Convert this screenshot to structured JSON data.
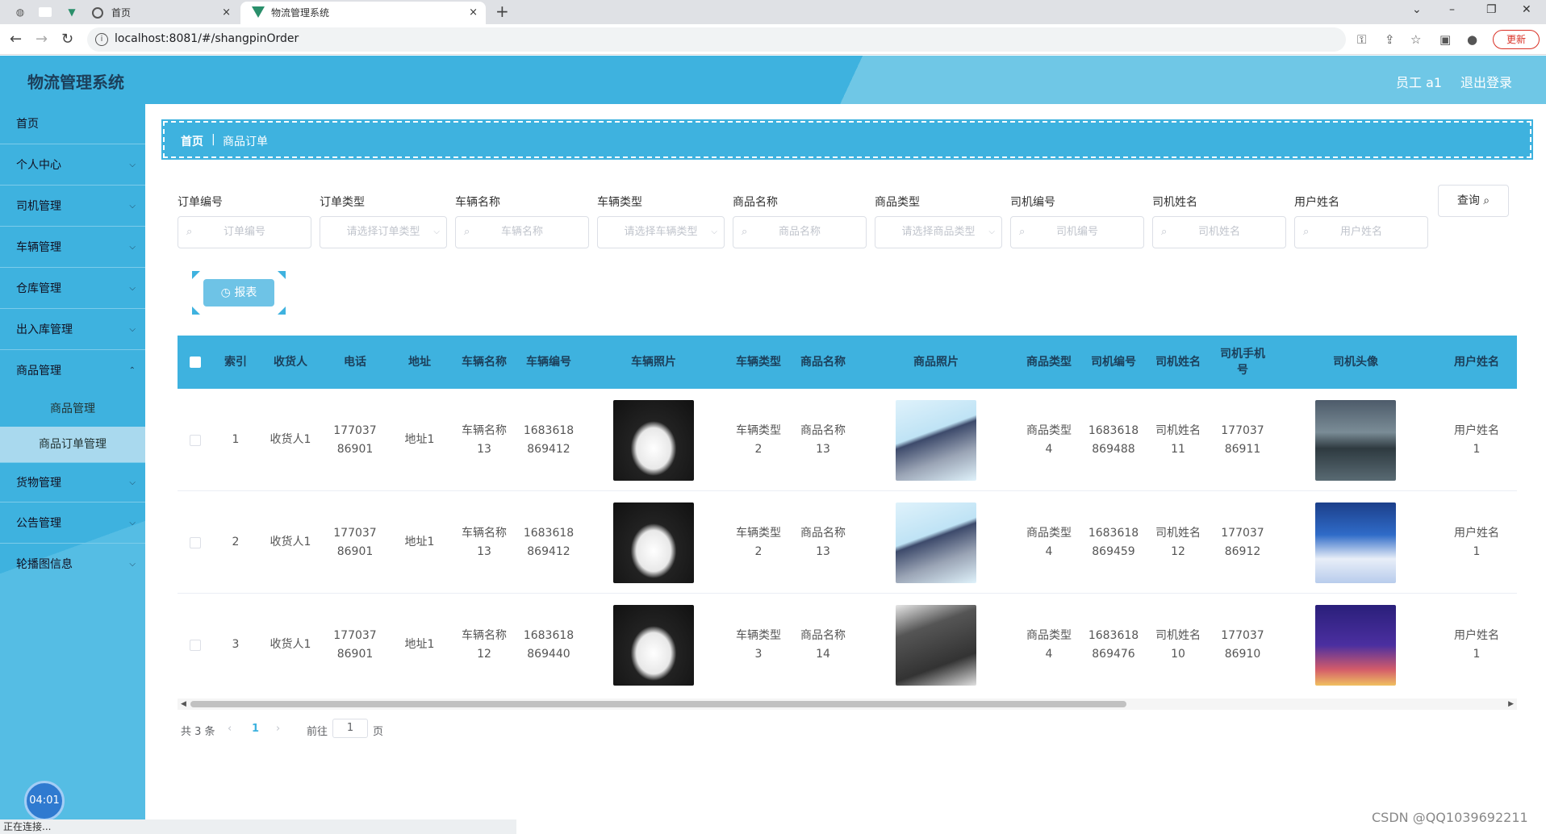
{
  "browser": {
    "tabs": [
      {
        "label": "首页"
      },
      {
        "label": "物流管理系统"
      }
    ],
    "url": "localhost:8081/#/shangpinOrder",
    "update_label": "更新",
    "new_tab_label": "+",
    "close_label": "×"
  },
  "header": {
    "app_name": "物流管理系统",
    "user": "员工 a1",
    "logout": "退出登录"
  },
  "sidebar": {
    "items": [
      {
        "label": "首页"
      },
      {
        "label": "个人中心"
      },
      {
        "label": "司机管理"
      },
      {
        "label": "车辆管理"
      },
      {
        "label": "仓库管理"
      },
      {
        "label": "出入库管理"
      },
      {
        "label": "商品管理"
      },
      {
        "label": "货物管理"
      },
      {
        "label": "公告管理"
      },
      {
        "label": "轮播图信息"
      }
    ],
    "subitems": [
      {
        "label": "商品管理"
      },
      {
        "label": "商品订单管理"
      }
    ]
  },
  "breadcrumb": {
    "home": "首页",
    "separator": "|",
    "current": "商品订单"
  },
  "search": {
    "fields": [
      {
        "label": "订单编号",
        "placeholder": "订单编号"
      },
      {
        "label": "订单类型",
        "placeholder": "请选择订单类型"
      },
      {
        "label": "车辆名称",
        "placeholder": "车辆名称"
      },
      {
        "label": "车辆类型",
        "placeholder": "请选择车辆类型"
      },
      {
        "label": "商品名称",
        "placeholder": "商品名称"
      },
      {
        "label": "商品类型",
        "placeholder": "请选择商品类型"
      },
      {
        "label": "司机编号",
        "placeholder": "司机编号"
      },
      {
        "label": "司机姓名",
        "placeholder": "司机姓名"
      },
      {
        "label": "用户姓名",
        "placeholder": "用户姓名"
      }
    ],
    "query_label": "查询",
    "report_label": "报表"
  },
  "table": {
    "headers": [
      "索引",
      "收货人",
      "电话",
      "地址",
      "车辆名称",
      "车辆编号",
      "车辆照片",
      "车辆类型",
      "商品名称",
      "商品照片",
      "商品类型",
      "司机编号",
      "司机姓名",
      "司机手机号",
      "司机头像",
      "用户姓名"
    ],
    "rows": [
      {
        "index": "1",
        "receiver": "收货人1",
        "phone": "17703786901",
        "address": "地址1",
        "vehicle_name": "车辆名称13",
        "vehicle_no": "1683618869412",
        "vehicle_type": "车辆类型2",
        "goods_name": "商品名称13",
        "goods_type": "商品类型4",
        "driver_no": "1683618869488",
        "driver_name": "司机姓名11",
        "driver_phone": "17703786911",
        "user_name": "用户姓名1"
      },
      {
        "index": "2",
        "receiver": "收货人1",
        "phone": "17703786901",
        "address": "地址1",
        "vehicle_name": "车辆名称13",
        "vehicle_no": "1683618869412",
        "vehicle_type": "车辆类型2",
        "goods_name": "商品名称13",
        "goods_type": "商品类型4",
        "driver_no": "1683618869459",
        "driver_name": "司机姓名12",
        "driver_phone": "17703786912",
        "user_name": "用户姓名1"
      },
      {
        "index": "3",
        "receiver": "收货人1",
        "phone": "17703786901",
        "address": "地址1",
        "vehicle_name": "车辆名称12",
        "vehicle_no": "1683618869440",
        "vehicle_type": "车辆类型3",
        "goods_name": "商品名称14",
        "goods_type": "商品类型4",
        "driver_no": "1683618869476",
        "driver_name": "司机姓名10",
        "driver_phone": "17703786910",
        "user_name": "用户姓名1"
      }
    ]
  },
  "pagination": {
    "total": "共 3 条",
    "current": "1",
    "goto_label": "前往",
    "page_value": "1",
    "page_suffix": "页"
  },
  "status_text": "正在连接...",
  "timer": "04:01",
  "watermark": "CSDN @QQ1039692211",
  "colors": {
    "accent": "#3eb2df",
    "header_dark": "#1c3f5a"
  }
}
